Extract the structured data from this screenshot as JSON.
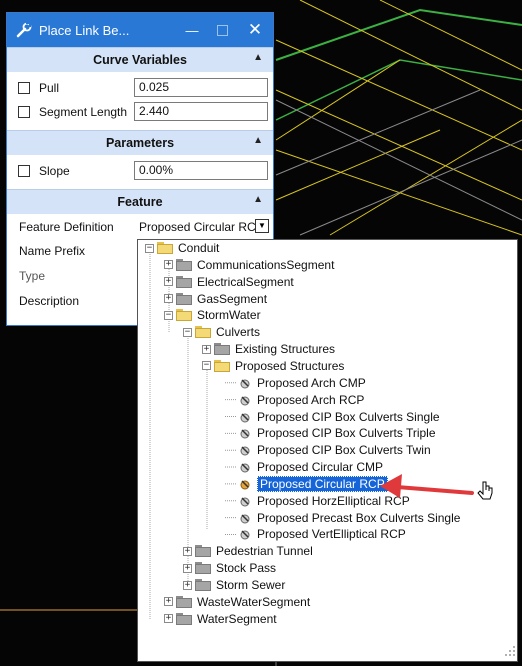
{
  "window": {
    "title": "Place Link Be...",
    "title_icon": "wrench-link-icon",
    "controls": [
      "minimize-icon",
      "maximize-icon",
      "close-icon"
    ]
  },
  "sections": {
    "curve_variables": {
      "title": "Curve Variables",
      "rows": [
        {
          "label": "Pull",
          "value": "0.025",
          "checked": false
        },
        {
          "label": "Segment Length",
          "value": "2.440",
          "checked": false
        }
      ]
    },
    "parameters": {
      "title": "Parameters",
      "rows": [
        {
          "label": "Slope",
          "value": "0.00%",
          "checked": false
        }
      ]
    },
    "feature": {
      "title": "Feature",
      "rows": [
        {
          "label": "Feature Definition",
          "value": "Proposed Circular RCP"
        },
        {
          "label": "Name Prefix",
          "value": ""
        },
        {
          "label": "Type",
          "value": ""
        },
        {
          "label": "Description",
          "value": ""
        }
      ]
    }
  },
  "tree": {
    "items": [
      {
        "label": "Conduit",
        "level": 0,
        "kind": "folder-open",
        "expander": "minus"
      },
      {
        "label": "CommunicationsSegment",
        "level": 1,
        "kind": "folder-closed",
        "expander": "plus"
      },
      {
        "label": "ElectricalSegment",
        "level": 1,
        "kind": "folder-closed",
        "expander": "plus"
      },
      {
        "label": "GasSegment",
        "level": 1,
        "kind": "folder-closed",
        "expander": "plus"
      },
      {
        "label": "StormWater",
        "level": 1,
        "kind": "folder-open",
        "expander": "minus"
      },
      {
        "label": "Culverts",
        "level": 2,
        "kind": "folder-open",
        "expander": "minus"
      },
      {
        "label": "Existing Structures",
        "level": 3,
        "kind": "folder-closed",
        "expander": "plus"
      },
      {
        "label": "Proposed Structures",
        "level": 3,
        "kind": "folder-open",
        "expander": "minus"
      },
      {
        "label": "Proposed Arch CMP",
        "level": 4,
        "kind": "leaf"
      },
      {
        "label": "Proposed Arch RCP",
        "level": 4,
        "kind": "leaf"
      },
      {
        "label": "Proposed CIP Box Culverts Single",
        "level": 4,
        "kind": "leaf"
      },
      {
        "label": "Proposed CIP Box Culverts Triple",
        "level": 4,
        "kind": "leaf"
      },
      {
        "label": "Proposed CIP Box Culverts Twin",
        "level": 4,
        "kind": "leaf"
      },
      {
        "label": "Proposed Circular CMP",
        "level": 4,
        "kind": "leaf"
      },
      {
        "label": "Proposed Circular RCP",
        "level": 4,
        "kind": "leaf",
        "selected": true
      },
      {
        "label": "Proposed HorzElliptical RCP",
        "level": 4,
        "kind": "leaf"
      },
      {
        "label": "Proposed Precast Box Culverts Single",
        "level": 4,
        "kind": "leaf"
      },
      {
        "label": "Proposed VertElliptical RCP",
        "level": 4,
        "kind": "leaf"
      },
      {
        "label": "Pedestrian Tunnel",
        "level": 2,
        "kind": "folder-closed",
        "expander": "plus"
      },
      {
        "label": "Stock Pass",
        "level": 2,
        "kind": "folder-closed",
        "expander": "plus"
      },
      {
        "label": "Storm Sewer",
        "level": 2,
        "kind": "folder-closed",
        "expander": "plus"
      },
      {
        "label": "WasteWaterSegment",
        "level": 1,
        "kind": "folder-closed",
        "expander": "plus"
      },
      {
        "label": "WaterSegment",
        "level": 1,
        "kind": "folder-closed",
        "expander": "plus"
      }
    ]
  },
  "colors": {
    "title_bar": "#2a78d6",
    "section_header": "#d4e3f7",
    "selection": "#1565d8",
    "annotation_arrow": "#e0393b",
    "cad_yellow": "#d8c520",
    "cad_green": "#3cb043"
  }
}
